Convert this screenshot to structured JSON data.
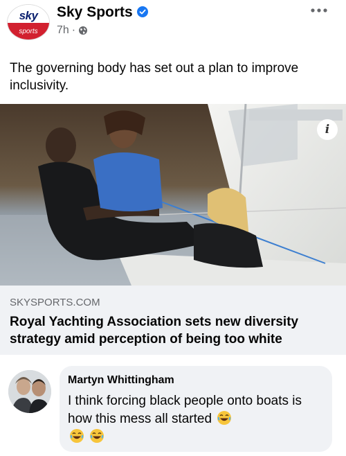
{
  "post": {
    "page_name": "Sky Sports",
    "avatar_logo_top": "sky",
    "avatar_logo_bottom": "sports",
    "time": "7h",
    "separator": "·",
    "text": "The governing body has set out a plan to improve inclusivity."
  },
  "link_preview": {
    "domain": "SKYSPORTS.COM",
    "title": "Royal Yachting Association sets new diversity strategy amid perception of being too white",
    "info_label": "i"
  },
  "comment": {
    "author": "Martyn Whittingham",
    "text": "I think forcing black people onto boats is how this mess all started"
  },
  "colors": {
    "brand_blue": "#1877f2",
    "sky_red": "#d2202f",
    "meta_grey": "#65676b",
    "bubble_bg": "#f0f2f5"
  },
  "icons": [
    "verified-icon",
    "globe-icon",
    "more-options-icon",
    "info-icon",
    "laughing-emoji-icon"
  ]
}
